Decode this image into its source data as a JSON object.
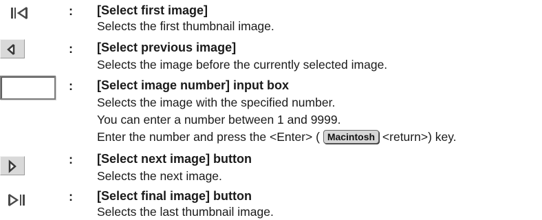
{
  "entries": [
    {
      "icon": "first-image-icon",
      "colon": ":",
      "title": "[Select first image]",
      "lines": [
        "Selects the first thumbnail image."
      ]
    },
    {
      "icon": "previous-image-icon",
      "colon": ":",
      "title": "[Select previous image]",
      "lines": [
        "Selects the image before the currently selected image."
      ]
    },
    {
      "icon": "image-number-input-box",
      "colon": ":",
      "title": "[Select image number] input box",
      "lines": [
        "Selects the image with the specified number.",
        "You can enter a number between 1 and 9999."
      ],
      "enter_line": {
        "before": "Enter the number and press the <Enter> ( ",
        "badge": "Macintosh",
        "after": " <return>) key."
      }
    },
    {
      "icon": "next-image-icon",
      "colon": ":",
      "title": "[Select next image] button",
      "lines": [
        "Selects the next image."
      ]
    },
    {
      "icon": "final-image-icon",
      "colon": ":",
      "title": "[Select final image] button",
      "lines": [
        "Selects the last thumbnail image."
      ]
    }
  ]
}
